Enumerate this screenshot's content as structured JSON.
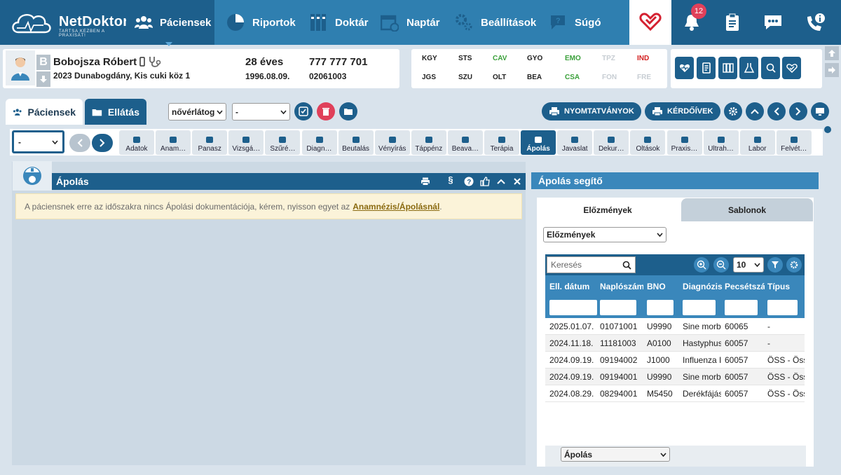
{
  "brand": {
    "name": "NetDoktor",
    "tagline": "TARTSA KÉZBEN A PRAXISÁT!"
  },
  "nav": {
    "pacientek": "Páciensek",
    "riportok": "Riportok",
    "doktar": "Doktár",
    "naptar": "Naptár",
    "beallitasok": "Beállítások",
    "sugo": "Súgó",
    "notifications": "12"
  },
  "patient": {
    "initial": "B",
    "name": "Bobojsza Róbert",
    "address": "2023 Dunabogdány, Kis cuki köz 1",
    "age": "28 éves",
    "birth": "1996.08.09.",
    "phone": "777 777 701",
    "id": "02061003"
  },
  "codes": {
    "row1": [
      {
        "t": "KGY",
        "c": "#222"
      },
      {
        "t": "STS",
        "c": "#222"
      },
      {
        "t": "CAV",
        "c": "#3aa03a"
      },
      {
        "t": "GYO",
        "c": "#222"
      },
      {
        "t": "EMO",
        "c": "#3aa03a"
      },
      {
        "t": "TPZ",
        "c": "#c7cdd3"
      },
      {
        "t": "IND",
        "c": "#d42020"
      }
    ],
    "row2": [
      {
        "t": "JGS",
        "c": "#222"
      },
      {
        "t": "SZU",
        "c": "#222"
      },
      {
        "t": "OLT",
        "c": "#222"
      },
      {
        "t": "BEA",
        "c": "#222"
      },
      {
        "t": "CSA",
        "c": "#3aa03a"
      },
      {
        "t": "FON",
        "c": "#c7cdd3"
      },
      {
        "t": "FRE",
        "c": "#c7cdd3"
      }
    ]
  },
  "tabs": {
    "pacientek": "Páciensek",
    "ellatas": "Ellátás",
    "view_select": "nővérlátog",
    "second_select": "-",
    "nyomtatvanyok": "NYOMTATVÁNYOK",
    "kerdoivek": "KÉRDŐÍVEK",
    "page_select": "-"
  },
  "subtabs": [
    "Adatok",
    "Anam…",
    "Panasz",
    "Vizsgá…",
    "Szűré…",
    "Diagn…",
    "Beutalás",
    "Vényírás",
    "Táppénz",
    "Beava…",
    "Terápia",
    "Ápolás",
    "Javaslat",
    "Dekur…",
    "Oltások",
    "Praxis…",
    "Ultrah…",
    "Labor",
    "Felvét…"
  ],
  "left": {
    "title": "Ápolás",
    "paragraph": "§",
    "notice": "A páciensnek erre az időszakra nincs Ápolási dokumentációja, kérem, nyisson egyet az",
    "notice_link": "Anamnézis/Ápolásnál",
    "notice_end": "."
  },
  "right": {
    "title": "Ápolás segítő",
    "tab1": "Előzmények",
    "tab2": "Sablonok",
    "select": "Előzmények",
    "search_placeholder": "Keresés",
    "page_size": "10",
    "bottom_select": "Ápolás",
    "columns": [
      "Ell. dátum",
      "Naplószám",
      "BNO",
      "Diagnózis",
      "Pecsétszám",
      "Típus"
    ],
    "rows": [
      [
        "2025.01.07.",
        "01071001",
        "U9990",
        "Sine morbo",
        "60065",
        "-"
      ],
      [
        "2024.11.18.",
        "11181003",
        "A0100",
        "Hastyphus",
        "60057",
        "-"
      ],
      [
        "2024.09.19.",
        "09194002",
        "J1000",
        "Influenza I",
        "60057",
        "ÖSS - Össz"
      ],
      [
        "2024.09.19.",
        "09194001",
        "U9990",
        "Sine morbo",
        "60057",
        "ÖSS - Össz"
      ],
      [
        "2024.08.29.",
        "08294001",
        "M5450",
        "Derékfájás",
        "60057",
        "ÖSS - Össz"
      ]
    ]
  },
  "colors": {
    "primary": "#1d5f8c",
    "accent": "#3a87bb",
    "alert": "#e0405a"
  }
}
